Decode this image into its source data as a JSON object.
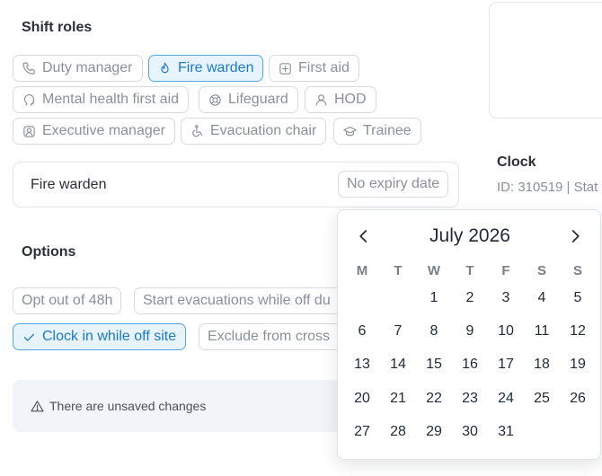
{
  "shift_roles": {
    "title": "Shift roles",
    "chips": [
      {
        "label": "Duty manager",
        "icon": "phone-icon",
        "active": false
      },
      {
        "label": "Fire warden",
        "icon": "flame-icon",
        "active": true
      },
      {
        "label": "First aid",
        "icon": "plus-square-icon",
        "active": false
      },
      {
        "label": "Mental health first aid",
        "icon": "head-icon",
        "active": false
      },
      {
        "label": "Lifeguard",
        "icon": "lifebuoy-icon",
        "active": false
      },
      {
        "label": "HOD",
        "icon": "user-icon",
        "active": false
      },
      {
        "label": "Executive manager",
        "icon": "user-square-icon",
        "active": false
      },
      {
        "label": "Evacuation chair",
        "icon": "wheelchair-icon",
        "active": false
      },
      {
        "label": "Trainee",
        "icon": "graduation-cap-icon",
        "active": false
      }
    ]
  },
  "role_card": {
    "label": "Fire warden",
    "expiry": "No expiry date"
  },
  "options": {
    "title": "Options",
    "chips": [
      {
        "label": "Opt out of 48h",
        "active": false
      },
      {
        "label": "Start evacuations while off du",
        "active": false
      },
      {
        "label": "Clock in while off site",
        "active": true,
        "icon": "check-icon"
      },
      {
        "label": "Exclude from cross",
        "active": false
      }
    ]
  },
  "banner": {
    "text": "There are unsaved changes",
    "icon": "warning-triangle-icon"
  },
  "clock": {
    "title": "Clock",
    "id_text": "ID: 310519 | Stat"
  },
  "calendar": {
    "month_label": "July 2026",
    "weekdays": [
      "M",
      "T",
      "W",
      "T",
      "F",
      "S",
      "S"
    ],
    "leading_blanks": 2,
    "days": [
      "1",
      "2",
      "3",
      "4",
      "5",
      "6",
      "7",
      "8",
      "9",
      "10",
      "11",
      "12",
      "13",
      "14",
      "15",
      "16",
      "17",
      "18",
      "19",
      "20",
      "21",
      "22",
      "23",
      "24",
      "25",
      "26",
      "27",
      "28",
      "29",
      "30",
      "31"
    ]
  },
  "colors": {
    "accent": "#1a7ac9",
    "accent_bg": "#e7f3fd",
    "muted_text": "#8a9099",
    "border": "#d7dbe0"
  }
}
